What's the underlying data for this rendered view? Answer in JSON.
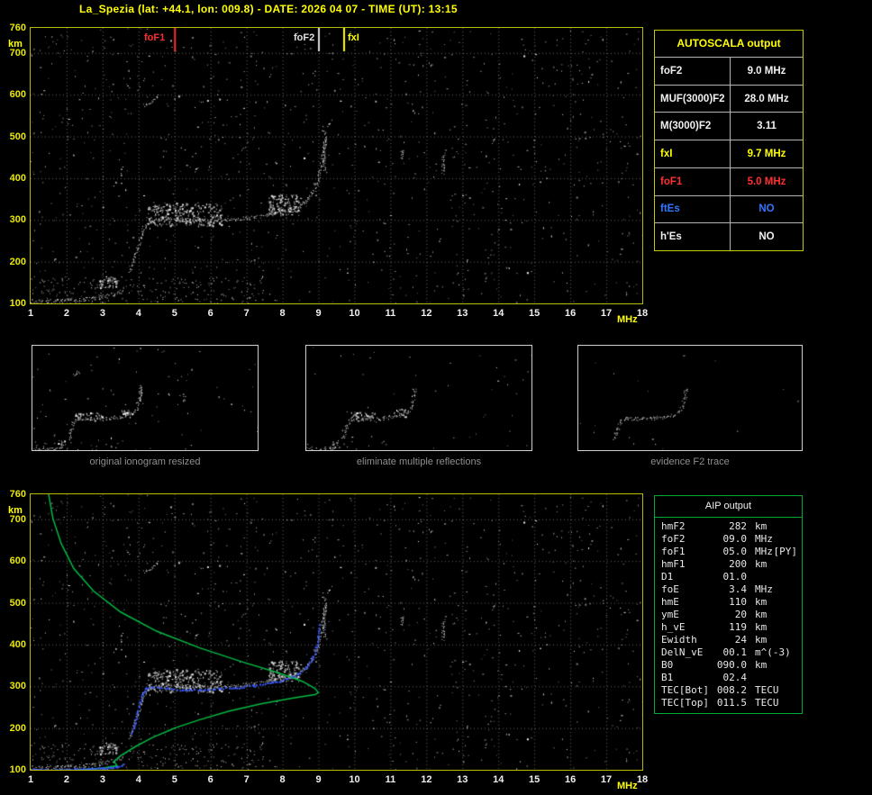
{
  "header": {
    "title": "La_Spezia (lat: +44.1, lon: 009.8) - DATE: 2026 04 07 - TIME (UT): 13:15"
  },
  "autoscala": {
    "title": "AUTOSCALA output",
    "rows": [
      {
        "label": "foF2",
        "value": "9.0 MHz",
        "color": "#f0f0f0"
      },
      {
        "label": "MUF(3000)F2",
        "value": "28.0 MHz",
        "color": "#f0f0f0"
      },
      {
        "label": "M(3000)F2",
        "value": "3.11",
        "color": "#f0f0f0"
      },
      {
        "label": "fxI",
        "value": "9.7 MHz",
        "color": "#ffff00"
      },
      {
        "label": "foF1",
        "value": "5.0 MHz",
        "color": "#ff3030"
      },
      {
        "label": "ftEs",
        "value": "NO",
        "color": "#3377ff"
      },
      {
        "label": "h'Es",
        "value": "NO",
        "color": "#f0f0f0"
      }
    ]
  },
  "thumbnails": {
    "captions": [
      "original ionogram resized",
      "eliminate multiple reflections",
      "evidence F2 trace"
    ]
  },
  "aip": {
    "title": "AIP output",
    "rows": [
      {
        "name": "hmF2",
        "value": "282",
        "unit": "km",
        "note": ""
      },
      {
        "name": "foF2",
        "value": "09.0",
        "unit": "MHz",
        "note": ""
      },
      {
        "name": "foF1",
        "value": "05.0",
        "unit": "MHz",
        "note": "[PY]"
      },
      {
        "name": "hmF1",
        "value": "200",
        "unit": "km",
        "note": ""
      },
      {
        "name": "D1",
        "value": "01.0",
        "unit": "",
        "note": ""
      },
      {
        "name": "foE",
        "value": "3.4",
        "unit": "MHz",
        "note": ""
      },
      {
        "name": "hmE",
        "value": "110",
        "unit": "km",
        "note": ""
      },
      {
        "name": "ymE",
        "value": "20",
        "unit": "km",
        "note": ""
      },
      {
        "name": "h_vE",
        "value": "119",
        "unit": "km",
        "note": ""
      },
      {
        "name": "Ewidth",
        "value": "24",
        "unit": "km",
        "note": ""
      },
      {
        "name": "DelN_vE",
        "value": "00.1",
        "unit": "m^(-3)",
        "note": ""
      },
      {
        "name": "B0",
        "value": "090.0",
        "unit": "km",
        "note": ""
      },
      {
        "name": "B1",
        "value": "02.4",
        "unit": "",
        "note": ""
      },
      {
        "name": "TEC[Bot]",
        "value": "008.2",
        "unit": "TECU",
        "note": ""
      },
      {
        "name": "TEC[Top]",
        "value": "011.5",
        "unit": "TECU",
        "note": ""
      }
    ]
  },
  "chart_data": {
    "type": "scatter",
    "title": "Ionogram with AUTOSCALA interpretation",
    "xlabel": "MHz",
    "ylabel": "km",
    "xlim": [
      1,
      18
    ],
    "ylim": [
      100,
      760
    ],
    "x_unit": "MHz",
    "y_unit": "km",
    "x_ticks": [
      1,
      2,
      3,
      4,
      5,
      6,
      7,
      8,
      9,
      10,
      11,
      12,
      13,
      14,
      15,
      16,
      17,
      18
    ],
    "y_ticks": [
      760,
      700,
      600,
      500,
      400,
      300,
      200,
      100
    ],
    "grid": true,
    "markers": [
      {
        "label": "foF1",
        "freq": 5.0,
        "color": "#ff3030"
      },
      {
        "label": "foF2",
        "freq": 9.0,
        "color": "#dddddd"
      },
      {
        "label": "fxI",
        "freq": 9.7,
        "color": "#ffff00"
      }
    ],
    "es_trace": [
      [
        1.0,
        106
      ],
      [
        1.4,
        104
      ],
      [
        1.9,
        106
      ],
      [
        2.4,
        109
      ],
      [
        2.8,
        113
      ],
      [
        3.2,
        120
      ],
      [
        3.6,
        130
      ]
    ],
    "f_trace": [
      [
        3.75,
        178
      ],
      [
        3.85,
        200
      ],
      [
        3.95,
        228
      ],
      [
        4.05,
        258
      ],
      [
        4.15,
        282
      ],
      [
        4.35,
        298
      ],
      [
        4.7,
        304
      ],
      [
        5.1,
        301
      ],
      [
        5.6,
        299
      ],
      [
        6.1,
        300
      ],
      [
        6.6,
        302
      ],
      [
        7.1,
        306
      ],
      [
        7.6,
        313
      ],
      [
        8.1,
        323
      ],
      [
        8.5,
        336
      ],
      [
        8.75,
        354
      ],
      [
        8.9,
        376
      ],
      [
        9.0,
        402
      ],
      [
        9.08,
        434
      ],
      [
        9.13,
        466
      ],
      [
        9.16,
        495
      ]
    ],
    "clusters": [
      {
        "f": [
          4.2,
          6.3
        ],
        "h": [
          286,
          342
        ],
        "count": 260
      },
      {
        "f": [
          7.6,
          8.5
        ],
        "h": [
          312,
          362
        ],
        "count": 130
      },
      {
        "f": [
          2.9,
          3.4
        ],
        "h": [
          138,
          162
        ],
        "count": 40
      }
    ],
    "multiple_echoes": [
      [
        [
          4.15,
          575
        ],
        [
          4.35,
          585
        ],
        [
          4.55,
          596
        ]
      ],
      [
        [
          9.15,
          420
        ],
        [
          9.18,
          515
        ]
      ],
      [
        [
          12.45,
          412
        ],
        [
          12.47,
          462
        ]
      ],
      [
        [
          11.3,
          448
        ],
        [
          11.32,
          472
        ]
      ]
    ],
    "profile_green": [
      [
        2.3,
        100
      ],
      [
        3.0,
        104
      ],
      [
        3.4,
        110
      ],
      [
        3.32,
        120
      ],
      [
        3.5,
        134
      ],
      [
        3.9,
        155
      ],
      [
        4.4,
        178
      ],
      [
        4.9,
        196
      ],
      [
        5.0,
        200
      ],
      [
        5.7,
        220
      ],
      [
        6.5,
        240
      ],
      [
        7.4,
        258
      ],
      [
        8.3,
        272
      ],
      [
        8.9,
        280
      ],
      [
        9.0,
        285
      ],
      [
        8.9,
        295
      ],
      [
        8.55,
        312
      ],
      [
        7.9,
        332
      ],
      [
        6.9,
        358
      ],
      [
        5.7,
        392
      ],
      [
        4.5,
        432
      ],
      [
        3.5,
        478
      ],
      [
        2.75,
        528
      ],
      [
        2.2,
        582
      ],
      [
        1.85,
        642
      ],
      [
        1.62,
        702
      ],
      [
        1.5,
        760
      ]
    ],
    "restored_trace": [
      [
        3.8,
        190
      ],
      [
        3.88,
        212
      ],
      [
        3.95,
        238
      ],
      [
        4.02,
        262
      ],
      [
        4.08,
        283
      ],
      [
        4.18,
        297
      ],
      [
        4.4,
        299
      ],
      [
        4.8,
        295
      ],
      [
        5.2,
        293
      ],
      [
        5.7,
        293
      ],
      [
        6.2,
        295
      ],
      [
        6.7,
        298
      ],
      [
        7.2,
        303
      ],
      [
        7.7,
        309
      ],
      [
        8.1,
        318
      ],
      [
        8.4,
        330
      ],
      [
        8.65,
        347
      ],
      [
        8.82,
        368
      ],
      [
        8.92,
        393
      ],
      [
        8.98,
        420
      ],
      [
        9.02,
        448
      ]
    ],
    "es_restored": [
      [
        1.0,
        102
      ],
      [
        1.7,
        101
      ],
      [
        2.4,
        103
      ],
      [
        3.0,
        105
      ],
      [
        3.4,
        108
      ],
      [
        3.55,
        114
      ]
    ],
    "noise": {
      "seed": 1337,
      "count": 1050
    },
    "colors": {
      "profile": "#00bb44",
      "restored": "#3b5bff",
      "plot_border": "#b9b900",
      "axis_y": "#e8e800",
      "axis_x": "#f0f0f0"
    },
    "panels": [
      {
        "canvas": "ionogram-main",
        "grid": true,
        "noise": 1,
        "es": true,
        "trace": true,
        "cluster": true,
        "mult": true,
        "markers": true,
        "overlay": false,
        "seed": 0
      },
      {
        "canvas": "thumb-original",
        "grid": false,
        "noise": 0.55,
        "es": true,
        "trace": true,
        "cluster": true,
        "mult": true,
        "markers": false,
        "overlay": false,
        "seed": 1
      },
      {
        "canvas": "thumb-clean",
        "grid": false,
        "noise": 0.3,
        "es": true,
        "trace": true,
        "cluster": true,
        "mult": false,
        "markers": false,
        "overlay": false,
        "seed": 2
      },
      {
        "canvas": "thumb-f2",
        "grid": false,
        "noise": 0.1,
        "es": false,
        "trace": true,
        "cluster": false,
        "mult": false,
        "markers": false,
        "overlay": false,
        "seed": 3
      },
      {
        "canvas": "ionogram-profile",
        "grid": true,
        "noise": 1,
        "es": true,
        "trace": true,
        "cluster": true,
        "mult": true,
        "markers": false,
        "overlay": true,
        "seed": 0
      }
    ]
  }
}
